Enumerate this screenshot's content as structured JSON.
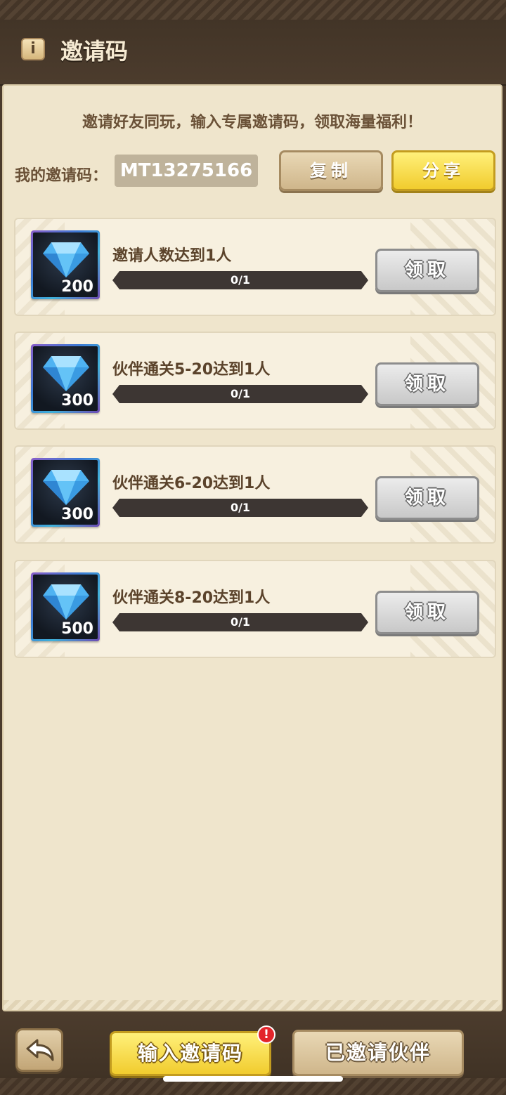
{
  "header": {
    "title": "邀请码",
    "info_icon": "info-icon"
  },
  "invite": {
    "subtitle": "邀请好友同玩，输入专属邀请码，领取海量福利！",
    "my_code_label": "我的邀请码：",
    "my_code": "MT13275166",
    "copy_label": "复制",
    "share_label": "分享"
  },
  "tasks": [
    {
      "title": "邀请人数达到1人",
      "reward_icon": "diamond-icon",
      "reward_amount": "200",
      "progress_text": "0/1",
      "progress": 0,
      "claim_label": "领取"
    },
    {
      "title": "伙伴通关5-20达到1人",
      "reward_icon": "diamond-icon",
      "reward_amount": "300",
      "progress_text": "0/1",
      "progress": 0,
      "claim_label": "领取"
    },
    {
      "title": "伙伴通关6-20达到1人",
      "reward_icon": "diamond-icon",
      "reward_amount": "300",
      "progress_text": "0/1",
      "progress": 0,
      "claim_label": "领取"
    },
    {
      "title": "伙伴通关8-20达到1人",
      "reward_icon": "diamond-icon",
      "reward_amount": "500",
      "progress_text": "0/1",
      "progress": 0,
      "claim_label": "领取"
    }
  ],
  "bottom": {
    "back_icon": "back-arrow-icon",
    "enter_code_label": "输入邀请码",
    "badge": "!",
    "invited_label": "已邀请伙伴"
  },
  "colors": {
    "header_bg": "#4a3a2b",
    "panel_bg": "#efe5cc",
    "yellow_button": "#f1cc2e",
    "tan_button": "#cfb68b",
    "gray_button": "#c8c8c8",
    "text_brown": "#5b432b",
    "badge_red": "#e3252b"
  }
}
